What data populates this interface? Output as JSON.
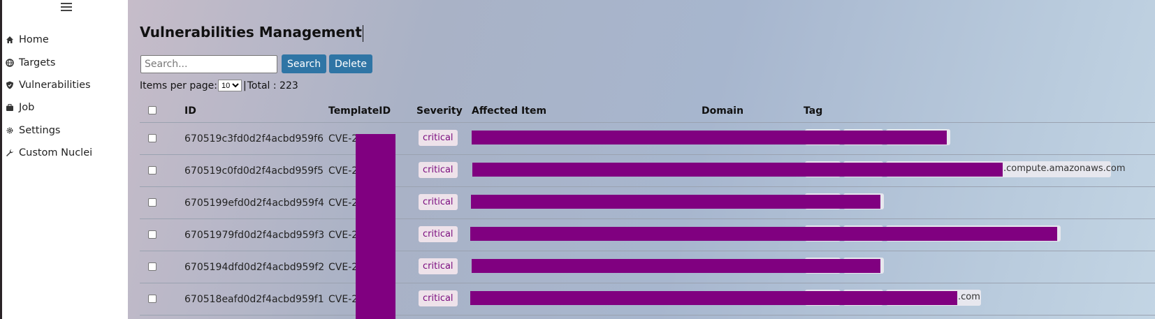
{
  "sidebar": {
    "menu_icon": "hamburger-icon",
    "items": [
      {
        "label": "Home",
        "icon": "home-icon"
      },
      {
        "label": "Targets",
        "icon": "globe-icon"
      },
      {
        "label": "Vulnerabilities",
        "icon": "shield-icon"
      },
      {
        "label": "Job",
        "icon": "briefcase-icon"
      },
      {
        "label": "Settings",
        "icon": "gear-icon"
      },
      {
        "label": "Custom Nuclei",
        "icon": "wrench-icon"
      }
    ]
  },
  "page": {
    "title": "Vulnerabilities Management",
    "search_placeholder": "Search...",
    "search_label": "Search",
    "delete_label": "Delete",
    "items_per_page_label": "Items per page:",
    "items_per_page_value": "10",
    "separator": "|",
    "total_label": "Total : 223"
  },
  "table": {
    "columns": [
      "ID",
      "TemplateID",
      "Severity",
      "Affected Item",
      "Domain",
      "Tag"
    ],
    "rows": [
      {
        "id": "670519c3fd0d2f4acbd959f6",
        "template": "CVE-20",
        "severity": "critical",
        "tag_suffix": ""
      },
      {
        "id": "670519c0fd0d2f4acbd959f5",
        "template": "CVE-20",
        "severity": "critical",
        "tag_suffix": ".compute.amazonaws.com"
      },
      {
        "id": "6705199efd0d2f4acbd959f4",
        "template": "CVE-20",
        "severity": "critical",
        "tag_suffix": ""
      },
      {
        "id": "67051979fd0d2f4acbd959f3",
        "template": "CVE-20",
        "severity": "critical",
        "tag_suffix": ""
      },
      {
        "id": "6705194dfd0d2f4acbd959f2",
        "template": "CVE-20",
        "severity": "critical",
        "tag_suffix": ""
      },
      {
        "id": "670518eafd0d2f4acbd959f1",
        "template": "CVE-20",
        "severity": "critical",
        "tag_suffix": ".com"
      }
    ]
  },
  "colors": {
    "redaction": "#800080",
    "button": "#2f75a5",
    "badge_text": "#7a0b7e"
  }
}
